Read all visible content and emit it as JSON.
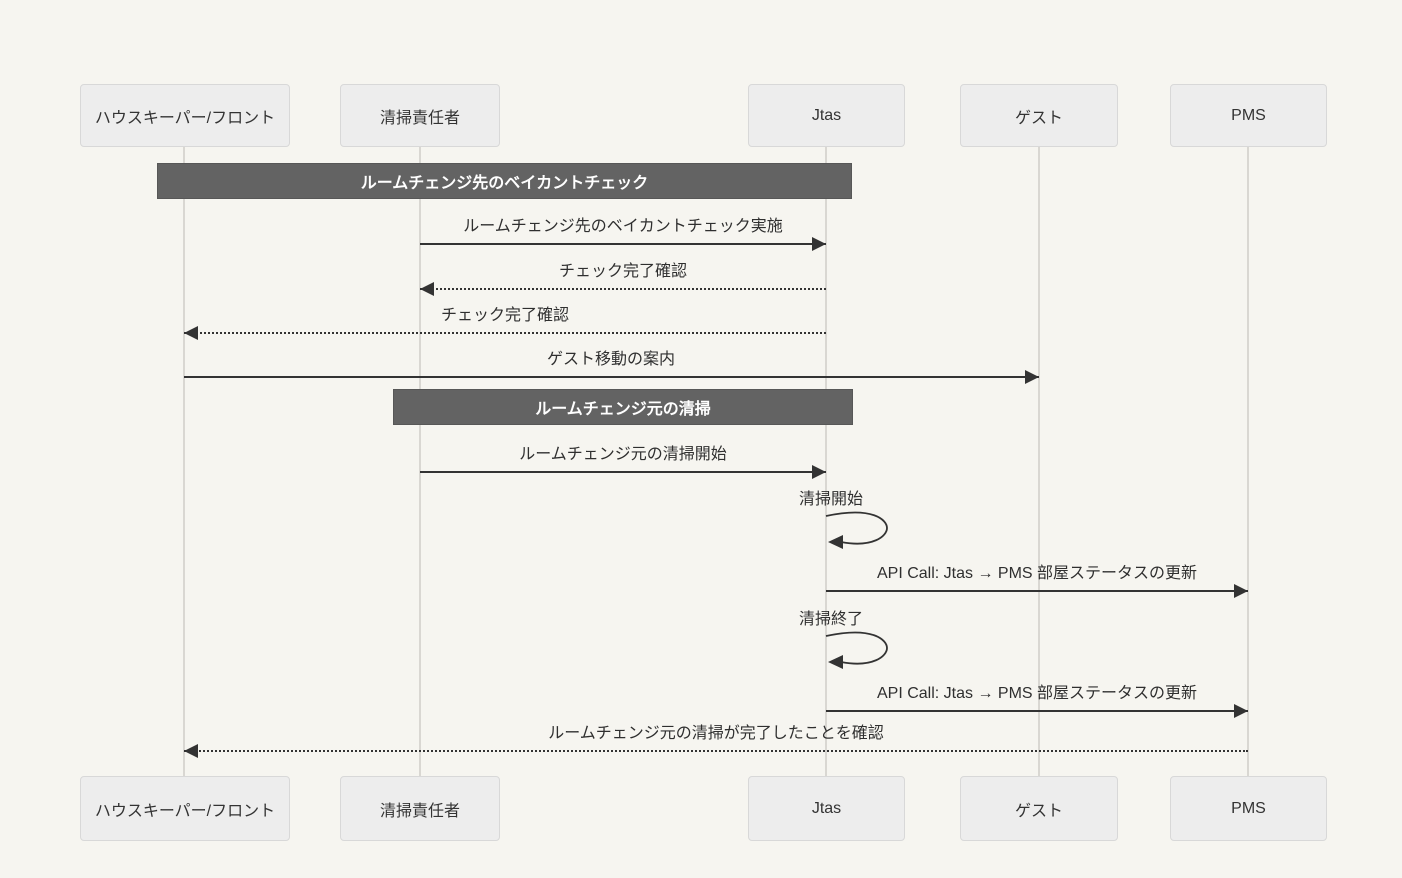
{
  "diagram": {
    "type": "sequence-diagram",
    "actors": [
      {
        "id": "housekeeper-front",
        "label": "ハウスキーパー/フロント"
      },
      {
        "id": "cleaning-manager",
        "label": "清掃責任者"
      },
      {
        "id": "jtas",
        "label": "Jtas"
      },
      {
        "id": "guest",
        "label": "ゲスト"
      },
      {
        "id": "pms",
        "label": "PMS"
      }
    ],
    "notes": [
      {
        "text": "ルームチェンジ先のベイカントチェック",
        "over": [
          "ハウスキーパー/フロント",
          "Jtas"
        ]
      },
      {
        "text": "ルームチェンジ元の清掃",
        "over": [
          "清掃責任者",
          "Jtas"
        ]
      }
    ],
    "messages": [
      {
        "text": "ルームチェンジ先のベイカントチェック実施",
        "from": "清掃責任者",
        "to": "Jtas",
        "line": "solid"
      },
      {
        "text": "チェック完了確認",
        "from": "Jtas",
        "to": "清掃責任者",
        "line": "dashed"
      },
      {
        "text": "チェック完了確認",
        "from": "Jtas",
        "to": "ハウスキーパー/フロント",
        "line": "dashed"
      },
      {
        "text": "ゲスト移動の案内",
        "from": "ハウスキーパー/フロント",
        "to": "ゲスト",
        "line": "solid"
      },
      {
        "text": "ルームチェンジ元の清掃開始",
        "from": "清掃責任者",
        "to": "Jtas",
        "line": "solid"
      },
      {
        "text": "清掃開始",
        "from": "Jtas",
        "to": "Jtas",
        "line": "self"
      },
      {
        "text": "API Call: Jtas → PMS 部屋ステータスの更新",
        "from": "Jtas",
        "to": "PMS",
        "line": "solid"
      },
      {
        "text": "清掃終了",
        "from": "Jtas",
        "to": "Jtas",
        "line": "self"
      },
      {
        "text": "API Call: Jtas → PMS 部屋ステータスの更新",
        "from": "Jtas",
        "to": "PMS",
        "line": "solid"
      },
      {
        "text": "ルームチェンジ元の清掃が完了したことを確認",
        "from": "PMS",
        "to": "ハウスキーパー/フロント",
        "line": "dashed"
      }
    ],
    "colors": {
      "background": "#f6f5f0",
      "actor_fill": "#ededed",
      "actor_border": "#d8d8d8",
      "note_fill": "#636363",
      "note_text": "#ffffff",
      "arrow": "#333333",
      "text": "#2f2f2f",
      "lifeline": "#d9d7d2"
    }
  }
}
